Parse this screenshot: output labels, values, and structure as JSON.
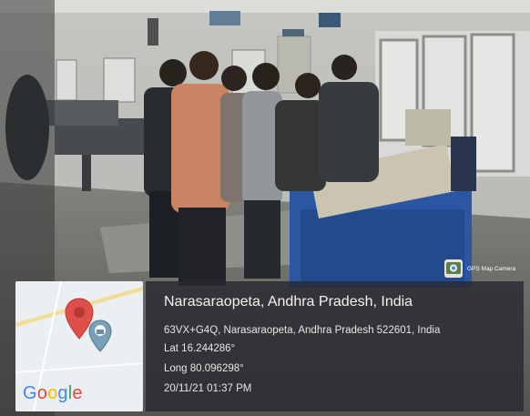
{
  "location": {
    "title": "Narasaraopeta, Andhra Pradesh, India",
    "address": "63VX+G4Q, Narasaraopeta, Andhra Pradesh 522601, India",
    "lat": "Lat 16.244286°",
    "long": "Long 80.096298°",
    "datetime": "20/11/21 01:37 PM"
  },
  "map": {
    "logo_text": "Google",
    "logo_letters": [
      {
        "ch": "G",
        "color": "#4285f4"
      },
      {
        "ch": "o",
        "color": "#ea4335"
      },
      {
        "ch": "o",
        "color": "#fbbc05"
      },
      {
        "ch": "g",
        "color": "#4285f4"
      },
      {
        "ch": "l",
        "color": "#34a853"
      },
      {
        "ch": "e",
        "color": "#ea4335"
      }
    ],
    "pin_color": "#e0504a",
    "secondary_pin_color": "#7aa0b8",
    "icons": [
      "map-pin-icon",
      "location-marker-icon"
    ]
  },
  "app_badge": {
    "label": "GPS Map Camera",
    "icon": "camera-map-icon"
  },
  "colors": {
    "overlay_bg": "#282a2e",
    "text": "#f2f2f2"
  }
}
